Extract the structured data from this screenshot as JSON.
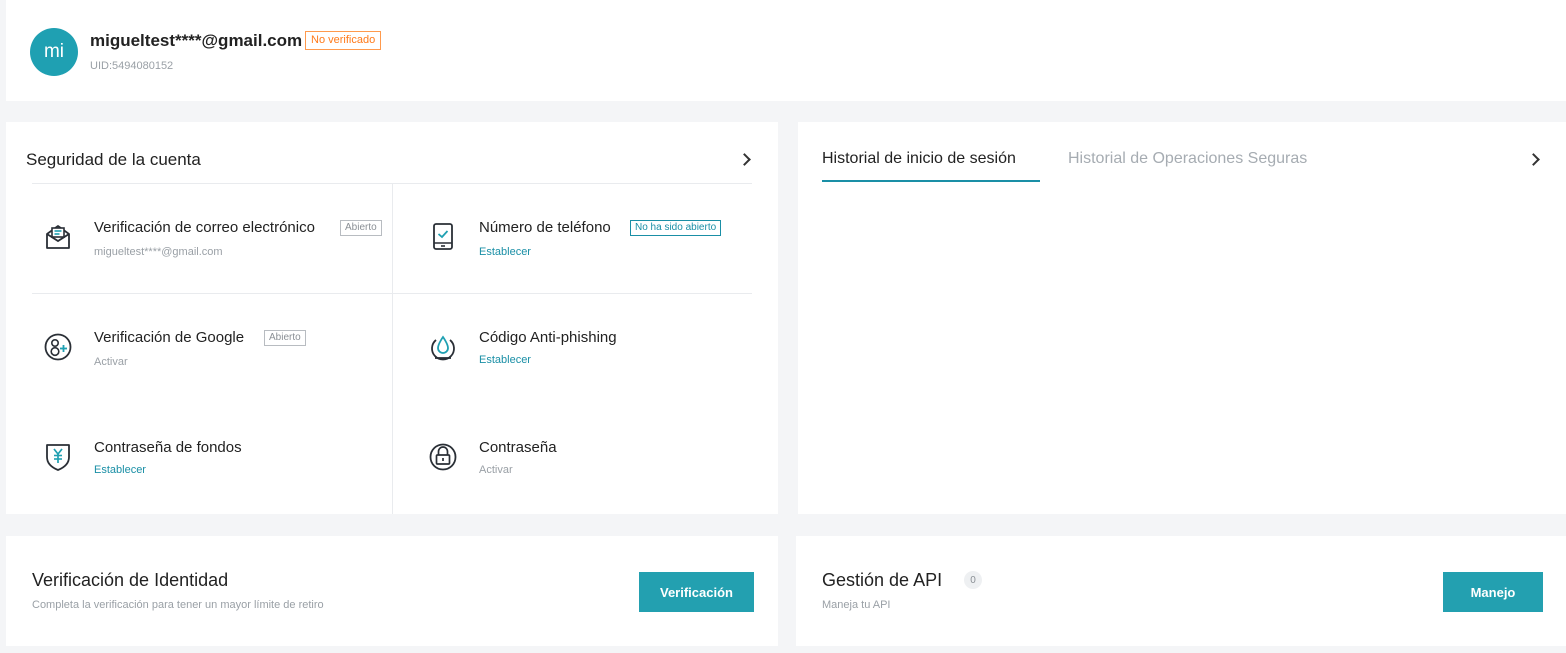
{
  "profile": {
    "avatar_initials": "mi",
    "email": "migueltest****@gmail.com",
    "verification_badge": "No verificado",
    "uid": "UID:5494080152",
    "accent_color": "#1fa0b2",
    "badge_color": "#ff7a1a"
  },
  "security": {
    "title": "Seguridad de la cuenta",
    "items": [
      {
        "icon": "email-icon",
        "title": "Verificación de correo electrónico",
        "badge": "Abierto",
        "subtitle": "migueltest****@gmail.com"
      },
      {
        "icon": "phone-icon",
        "title": "Número de teléfono",
        "badge": "No ha sido abierto",
        "subtitle": "Establecer"
      },
      {
        "icon": "google-auth-icon",
        "title": "Verificación de Google",
        "badge": "Abierto",
        "subtitle": "Activar"
      },
      {
        "icon": "anti-phishing-icon",
        "title": "Código Anti-phishing",
        "subtitle": "Establecer"
      },
      {
        "icon": "fund-shield-icon",
        "title": "Contraseña de fondos",
        "subtitle": "Establecer"
      },
      {
        "icon": "lock-icon",
        "title": "Contraseña",
        "subtitle": "Activar"
      }
    ]
  },
  "history": {
    "tabs": [
      {
        "label": "Historial de inicio de sesión",
        "active": true
      },
      {
        "label": "Historial de Operaciones Seguras",
        "active": false
      }
    ]
  },
  "identity": {
    "title": "Verificación de Identidad",
    "subtitle": "Completa la verificación para tener un mayor límite de retiro",
    "button_label": "Verificación"
  },
  "api": {
    "title": "Gestión de API",
    "count": "0",
    "subtitle": "Maneja tu API",
    "button_label": "Manejo"
  },
  "colors": {
    "link": "#1a8fa6",
    "button": "#23a0b0"
  }
}
